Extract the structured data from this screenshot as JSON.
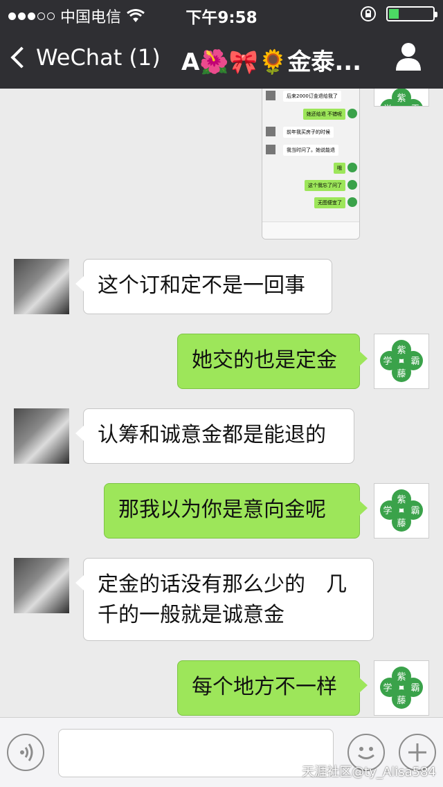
{
  "status": {
    "carrier": "中国电信",
    "time": "下午9:58"
  },
  "nav": {
    "back_label": "WeChat (1)",
    "title": "A🌺🎀🌻金泰..."
  },
  "shot": {
    "rows": [
      "后来2000订金退给我了",
      "她还给退 不错呢",
      "前年我买房子的时候",
      "我当时问了。她说能退",
      "哦",
      "这个我忘了问了",
      "无图便宜了"
    ]
  },
  "messages": [
    {
      "side": "in",
      "text": "这个订和定不是一回事"
    },
    {
      "side": "out",
      "text": "她交的也是定金"
    },
    {
      "side": "in",
      "text": "认筹和诚意金都是能退的"
    },
    {
      "side": "out",
      "text": "那我以为你是意向金呢"
    },
    {
      "side": "in",
      "text": "定金的话没有那么少的　几千的一般就是诚意金"
    },
    {
      "side": "out",
      "text": "每个地方不一样"
    }
  ],
  "clover_avatar": {
    "chars": [
      "紫",
      "学",
      "霸",
      "藤"
    ],
    "color": "#3aa24a"
  },
  "colors": {
    "nav_bg": "#2f2f33",
    "out_bubble": "#9de65a",
    "in_bubble": "#ffffff",
    "chat_bg": "#ebebeb"
  },
  "watermark": "天涯社区@ty_Alisa584"
}
